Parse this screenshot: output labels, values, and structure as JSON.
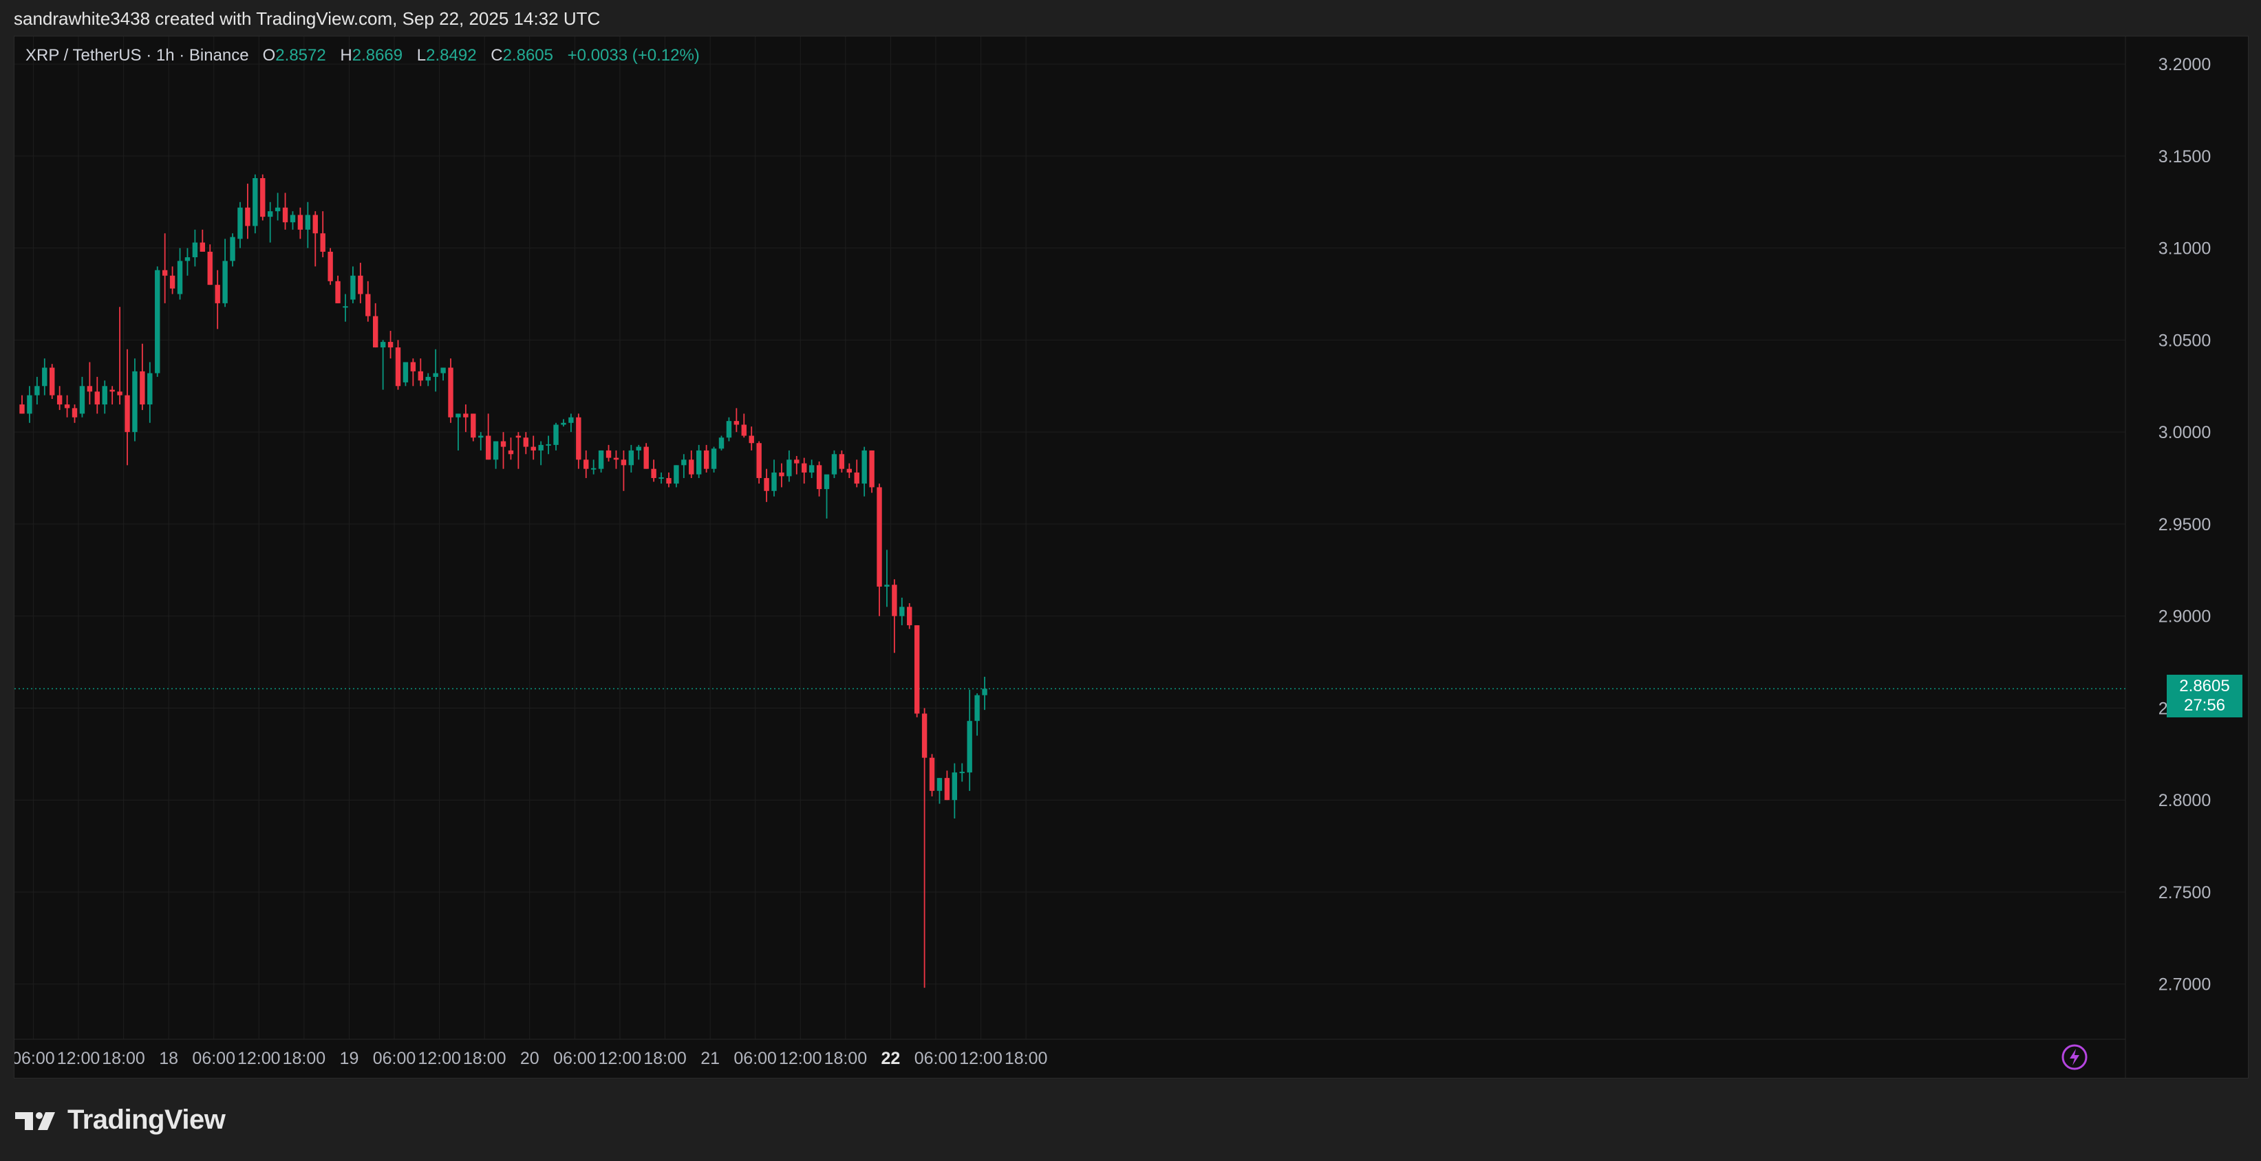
{
  "caption": "sandrawhite3438 created with TradingView.com, Sep 22, 2025 14:32 UTC",
  "legend": {
    "symbol": "XRP / TetherUS · 1h · Binance",
    "open_label": "O",
    "open": "2.8572",
    "high_label": "H",
    "high": "2.8669",
    "low_label": "L",
    "low": "2.8492",
    "close_label": "C",
    "close": "2.8605",
    "change": "+0.0033 (+0.12%)"
  },
  "price_tag": {
    "price": "2.8605",
    "countdown": "27:56"
  },
  "brand": {
    "name": "TradingView",
    "icon": "tradingview-logo-icon"
  },
  "colors": {
    "up": "#089981",
    "down": "#f23645",
    "background": "#0f0f0f",
    "grid": "#1e1e1e",
    "axis_text": "#b2b5be",
    "last_price_line": "#089981",
    "bolt": "#b545e0"
  },
  "chart_data": {
    "type": "candlestick",
    "ylim": [
      2.67,
      3.215
    ],
    "y_ticks": [
      "3.2000",
      "3.1500",
      "3.1000",
      "3.0500",
      "3.0000",
      "2.9500",
      "2.9000",
      "2.8500",
      "2.8000",
      "2.7500",
      "2.7000"
    ],
    "y_tick_values": [
      3.2,
      3.15,
      3.1,
      3.05,
      3.0,
      2.95,
      2.9,
      2.85,
      2.8,
      2.75,
      2.7
    ],
    "x_ticks": [
      {
        "label": "06:00",
        "bar": 1.5
      },
      {
        "label": "12:00",
        "bar": 7.5
      },
      {
        "label": "18:00",
        "bar": 13.5
      },
      {
        "label": "18",
        "bar": 19.5
      },
      {
        "label": "06:00",
        "bar": 25.5
      },
      {
        "label": "12:00",
        "bar": 31.5
      },
      {
        "label": "18:00",
        "bar": 37.5
      },
      {
        "label": "19",
        "bar": 43.5
      },
      {
        "label": "06:00",
        "bar": 49.5
      },
      {
        "label": "12:00",
        "bar": 55.5
      },
      {
        "label": "18:00",
        "bar": 61.5
      },
      {
        "label": "20",
        "bar": 67.5
      },
      {
        "label": "06:00",
        "bar": 73.5
      },
      {
        "label": "12:00",
        "bar": 79.5
      },
      {
        "label": "18:00",
        "bar": 85.5
      },
      {
        "label": "21",
        "bar": 91.5
      },
      {
        "label": "06:00",
        "bar": 97.5
      },
      {
        "label": "12:00",
        "bar": 103.5
      },
      {
        "label": "18:00",
        "bar": 109.5
      },
      {
        "label": "22",
        "bar": 115.5,
        "bold": true
      },
      {
        "label": "06:00",
        "bar": 121.5
      },
      {
        "label": "12:00",
        "bar": 127.5
      },
      {
        "label": "18:00",
        "bar": 133.5
      }
    ],
    "last_price": 2.8605,
    "candles": [
      [
        3.015,
        3.02,
        3.01,
        3.01
      ],
      [
        3.01,
        3.025,
        3.005,
        3.02
      ],
      [
        3.02,
        3.03,
        3.015,
        3.025
      ],
      [
        3.025,
        3.04,
        3.02,
        3.035
      ],
      [
        3.035,
        3.037,
        3.018,
        3.02
      ],
      [
        3.02,
        3.025,
        3.012,
        3.015
      ],
      [
        3.015,
        3.02,
        3.008,
        3.013
      ],
      [
        3.013,
        3.015,
        3.005,
        3.008
      ],
      [
        3.01,
        3.03,
        3.008,
        3.025
      ],
      [
        3.025,
        3.038,
        3.015,
        3.022
      ],
      [
        3.022,
        3.03,
        3.01,
        3.015
      ],
      [
        3.015,
        3.028,
        3.01,
        3.025
      ],
      [
        3.023,
        3.025,
        3.015,
        3.022
      ],
      [
        3.022,
        3.068,
        3.015,
        3.02
      ],
      [
        3.02,
        3.045,
        2.982,
        3.0
      ],
      [
        3.0,
        3.04,
        2.995,
        3.033
      ],
      [
        3.033,
        3.048,
        3.012,
        3.015
      ],
      [
        3.015,
        3.038,
        3.005,
        3.032
      ],
      [
        3.032,
        3.09,
        3.03,
        3.088
      ],
      [
        3.088,
        3.108,
        3.07,
        3.085
      ],
      [
        3.085,
        3.09,
        3.075,
        3.078
      ],
      [
        3.075,
        3.1,
        3.072,
        3.093
      ],
      [
        3.093,
        3.1,
        3.085,
        3.095
      ],
      [
        3.095,
        3.11,
        3.09,
        3.103
      ],
      [
        3.103,
        3.11,
        3.1,
        3.098
      ],
      [
        3.098,
        3.102,
        3.08,
        3.08
      ],
      [
        3.08,
        3.088,
        3.056,
        3.07
      ],
      [
        3.07,
        3.105,
        3.068,
        3.093
      ],
      [
        3.093,
        3.108,
        3.09,
        3.106
      ],
      [
        3.105,
        3.125,
        3.1,
        3.122
      ],
      [
        3.122,
        3.135,
        3.105,
        3.112
      ],
      [
        3.112,
        3.14,
        3.108,
        3.138
      ],
      [
        3.138,
        3.14,
        3.115,
        3.117
      ],
      [
        3.117,
        3.125,
        3.103,
        3.12
      ],
      [
        3.12,
        3.13,
        3.115,
        3.122
      ],
      [
        3.122,
        3.13,
        3.11,
        3.114
      ],
      [
        3.114,
        3.12,
        3.11,
        3.118
      ],
      [
        3.118,
        3.122,
        3.105,
        3.11
      ],
      [
        3.11,
        3.125,
        3.1,
        3.118
      ],
      [
        3.118,
        3.12,
        3.09,
        3.108
      ],
      [
        3.108,
        3.12,
        3.095,
        3.098
      ],
      [
        3.098,
        3.1,
        3.08,
        3.082
      ],
      [
        3.082,
        3.085,
        3.07,
        3.07
      ],
      [
        3.068,
        3.075,
        3.06,
        3.068
      ],
      [
        3.072,
        3.09,
        3.07,
        3.085
      ],
      [
        3.085,
        3.092,
        3.07,
        3.075
      ],
      [
        3.075,
        3.082,
        3.06,
        3.063
      ],
      [
        3.063,
        3.07,
        3.046,
        3.046
      ],
      [
        3.046,
        3.05,
        3.023,
        3.049
      ],
      [
        3.049,
        3.055,
        3.04,
        3.046
      ],
      [
        3.046,
        3.05,
        3.023,
        3.025
      ],
      [
        3.027,
        3.035,
        3.025,
        3.038
      ],
      [
        3.038,
        3.04,
        3.025,
        3.033
      ],
      [
        3.033,
        3.04,
        3.025,
        3.028
      ],
      [
        3.028,
        3.032,
        3.025,
        3.03
      ],
      [
        3.03,
        3.045,
        3.022,
        3.032
      ],
      [
        3.032,
        3.035,
        3.028,
        3.035
      ],
      [
        3.035,
        3.04,
        3.005,
        3.008
      ],
      [
        3.008,
        3.01,
        2.99,
        3.01
      ],
      [
        3.01,
        3.015,
        3.0,
        3.008
      ],
      [
        3.01,
        3.01,
        2.995,
        2.997
      ],
      [
        2.997,
        3.0,
        2.99,
        2.998
      ],
      [
        2.998,
        3.01,
        2.985,
        2.985
      ],
      [
        2.985,
        2.995,
        2.98,
        2.995
      ],
      [
        2.995,
        3.0,
        2.98,
        2.992
      ],
      [
        2.99,
        2.997,
        2.985,
        2.988
      ],
      [
        2.998,
        3.0,
        2.98,
        2.997
      ],
      [
        2.997,
        3.0,
        2.988,
        2.992
      ],
      [
        2.992,
        2.998,
        2.985,
        2.99
      ],
      [
        2.99,
        2.995,
        2.982,
        2.993
      ],
      [
        2.993,
        2.998,
        2.988,
        2.993
      ],
      [
        2.993,
        3.005,
        2.99,
        3.004
      ],
      [
        3.004,
        3.007,
        3.003,
        3.005
      ],
      [
        3.005,
        3.01,
        3.0,
        3.008
      ],
      [
        3.008,
        3.01,
        2.98,
        2.985
      ],
      [
        2.985,
        2.99,
        2.975,
        2.98
      ],
      [
        2.98,
        2.985,
        2.977,
        2.98
      ],
      [
        2.98,
        2.99,
        2.978,
        2.99
      ],
      [
        2.99,
        2.993,
        2.984,
        2.986
      ],
      [
        2.986,
        2.99,
        2.98,
        2.985
      ],
      [
        2.985,
        2.99,
        2.968,
        2.982
      ],
      [
        2.982,
        2.993,
        2.978,
        2.99
      ],
      [
        2.99,
        2.993,
        2.985,
        2.992
      ],
      [
        2.992,
        2.994,
        2.98,
        2.98
      ],
      [
        2.98,
        2.985,
        2.973,
        2.975
      ],
      [
        2.975,
        2.978,
        2.972,
        2.975
      ],
      [
        2.975,
        2.978,
        2.97,
        2.972
      ],
      [
        2.972,
        2.982,
        2.97,
        2.982
      ],
      [
        2.982,
        2.988,
        2.975,
        2.985
      ],
      [
        2.985,
        2.99,
        2.975,
        2.977
      ],
      [
        2.977,
        2.993,
        2.975,
        2.99
      ],
      [
        2.99,
        2.993,
        2.978,
        2.98
      ],
      [
        2.98,
        2.992,
        2.978,
        2.991
      ],
      [
        2.991,
        2.998,
        2.99,
        2.997
      ],
      [
        2.997,
        3.008,
        2.995,
        3.006
      ],
      [
        3.006,
        3.013,
        3.0,
        3.004
      ],
      [
        3.004,
        3.01,
        2.997,
        2.998
      ],
      [
        2.998,
        3.003,
        2.99,
        2.994
      ],
      [
        2.994,
        2.995,
        2.972,
        2.975
      ],
      [
        2.975,
        2.98,
        2.962,
        2.968
      ],
      [
        2.968,
        2.985,
        2.965,
        2.978
      ],
      [
        2.978,
        2.983,
        2.97,
        2.976
      ],
      [
        2.976,
        2.99,
        2.973,
        2.985
      ],
      [
        2.985,
        2.987,
        2.977,
        2.983
      ],
      [
        2.983,
        2.986,
        2.972,
        2.978
      ],
      [
        2.978,
        2.985,
        2.975,
        2.982
      ],
      [
        2.982,
        2.984,
        2.965,
        2.969
      ],
      [
        2.969,
        2.976,
        2.953,
        2.977
      ],
      [
        2.977,
        2.99,
        2.975,
        2.988
      ],
      [
        2.988,
        2.99,
        2.978,
        2.98
      ],
      [
        2.98,
        2.983,
        2.975,
        2.978
      ],
      [
        2.978,
        2.985,
        2.97,
        2.972
      ],
      [
        2.972,
        2.992,
        2.965,
        2.99
      ],
      [
        2.99,
        2.99,
        2.967,
        2.97
      ],
      [
        2.97,
        2.972,
        2.9,
        2.916
      ],
      [
        2.916,
        2.936,
        2.905,
        2.917
      ],
      [
        2.917,
        2.92,
        2.88,
        2.9
      ],
      [
        2.9,
        2.91,
        2.895,
        2.905
      ],
      [
        2.905,
        2.907,
        2.893,
        2.895
      ],
      [
        2.895,
        2.895,
        2.845,
        2.847
      ],
      [
        2.847,
        2.85,
        2.698,
        2.823
      ],
      [
        2.823,
        2.825,
        2.802,
        2.805
      ],
      [
        2.805,
        2.812,
        2.798,
        2.812
      ],
      [
        2.812,
        2.816,
        2.8,
        2.8
      ],
      [
        2.8,
        2.82,
        2.79,
        2.815
      ],
      [
        2.815,
        2.82,
        2.81,
        2.815
      ],
      [
        2.815,
        2.86,
        2.805,
        2.843
      ],
      [
        2.843,
        2.858,
        2.835,
        2.857
      ],
      [
        2.857,
        2.867,
        2.849,
        2.8605
      ]
    ]
  }
}
